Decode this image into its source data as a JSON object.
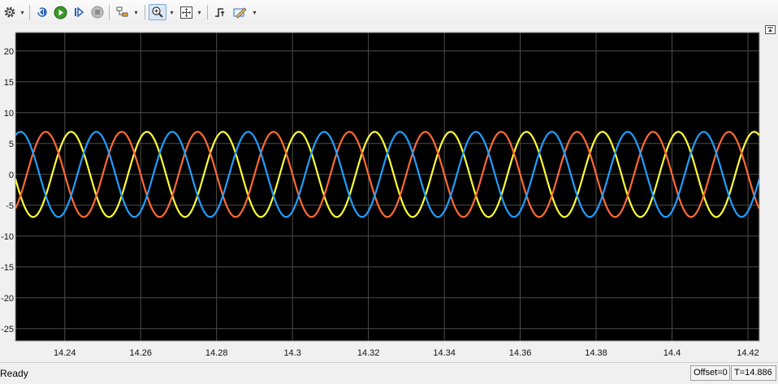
{
  "toolbar": {
    "buttons": [
      {
        "name": "settings-button",
        "icon": "gear-icon"
      },
      {
        "name": "step-back-button",
        "icon": "step-back-icon"
      },
      {
        "name": "run-button",
        "icon": "play-icon"
      },
      {
        "name": "step-forward-button",
        "icon": "step-forward-icon"
      },
      {
        "name": "stop-button",
        "icon": "stop-icon"
      },
      {
        "name": "highlight-block-button",
        "icon": "block-diagram-icon"
      },
      {
        "name": "zoom-button",
        "icon": "zoom-in-icon",
        "active": true
      },
      {
        "name": "autoscale-button",
        "icon": "autoscale-icon"
      },
      {
        "name": "triggers-button",
        "icon": "trigger-icon"
      },
      {
        "name": "measurements-button",
        "icon": "pen-ruler-icon"
      }
    ]
  },
  "colors": {
    "plot_background": "#000000",
    "grid": "#4d4d4d",
    "axes_frame": "#a0a0a0",
    "tick_label": "#d9d9d9",
    "series": [
      "#ffff33",
      "#ff6a33",
      "#1f9fff"
    ]
  },
  "chart_data": {
    "type": "line",
    "title": "",
    "xlabel": "",
    "ylabel": "",
    "xlim": [
      14.227,
      14.423
    ],
    "ylim": [
      -27,
      23
    ],
    "xticks": [
      "14.24",
      "14.26",
      "14.28",
      "14.3",
      "14.32",
      "14.34",
      "14.36",
      "14.38",
      "14.4",
      "14.42"
    ],
    "xtick_values": [
      14.24,
      14.26,
      14.28,
      14.3,
      14.32,
      14.34,
      14.36,
      14.38,
      14.4,
      14.42
    ],
    "yticks": [
      "20",
      "15",
      "10",
      "5",
      "0",
      "-5",
      "-10",
      "-15",
      "-20",
      "-25"
    ],
    "ytick_values": [
      20,
      15,
      10,
      5,
      0,
      -5,
      -10,
      -15,
      -20,
      -25
    ],
    "grid": true,
    "series_model": "three-phase sinusoids, frequency 50 Hz, amplitude about 7",
    "series": [
      {
        "color": "#ffff33",
        "amplitude": 6.9,
        "frequency_hz": 50,
        "phase_deg": 60
      },
      {
        "color": "#ff6a33",
        "amplitude": 6.9,
        "frequency_hz": 50,
        "phase_deg": 180
      },
      {
        "color": "#1f9fff",
        "amplitude": 6.9,
        "frequency_hz": 50,
        "phase_deg": 300
      }
    ]
  },
  "status": {
    "state": "Ready",
    "offset": "Offset=0",
    "time": "T=14.886"
  }
}
